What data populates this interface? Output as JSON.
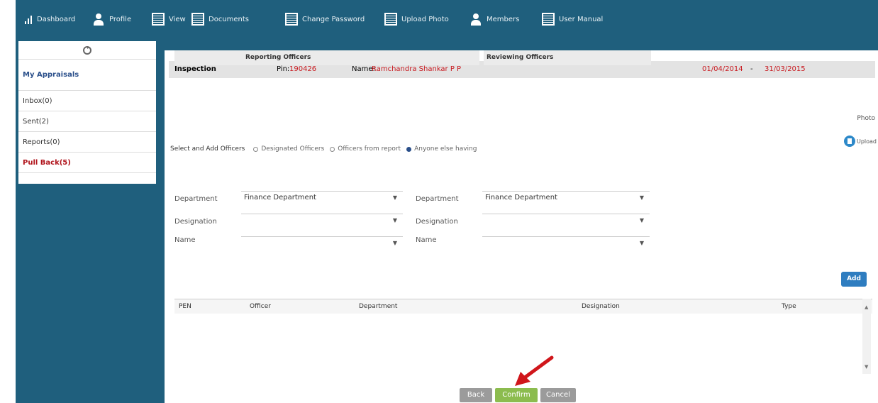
{
  "nav": {
    "items": [
      {
        "label": "Dashboard",
        "icon": "bar-chart-icon"
      },
      {
        "label": "Profile",
        "icon": "user-icon"
      },
      {
        "label": "View",
        "icon": "document-icon"
      },
      {
        "label": "Documents",
        "icon": "document-icon"
      },
      {
        "label": "Change Password",
        "icon": "document-icon"
      },
      {
        "label": "Upload Photo",
        "icon": "document-icon"
      },
      {
        "label": "Members",
        "icon": "user-icon"
      },
      {
        "label": "User Manual",
        "icon": "document-icon"
      }
    ]
  },
  "sidebar": {
    "items": [
      {
        "label": "My Appraisals"
      },
      {
        "label": "Inbox(0)"
      },
      {
        "label": "Sent(2)"
      },
      {
        "label": "Reports(0)"
      },
      {
        "label": "Pull Back(5)"
      }
    ]
  },
  "info": {
    "type": "Inspection",
    "pin_label": "Pin:",
    "pin_value": "190426",
    "name_label": "Name:",
    "name_value": "Ramchandra Shankar P P",
    "period_from": "01/04/2014",
    "period_sep": "-",
    "period_to": "31/03/2015"
  },
  "upload": {
    "top_label": "Photo",
    "button_label": "Upload"
  },
  "selection": {
    "lead": "Select and Add Officers",
    "options": [
      {
        "label": "Designated Officers",
        "selected": false
      },
      {
        "label": "Officers from report",
        "selected": false
      },
      {
        "label": "Anyone else having",
        "selected": true
      }
    ]
  },
  "reporting": {
    "header": "Reporting Officers",
    "department_label": "Department",
    "department_value": "Finance Department",
    "designation_label": "Designation",
    "designation_value": "",
    "name_label": "Name",
    "name_value": ""
  },
  "reviewing": {
    "header": "Reviewing Officers",
    "department_label": "Department",
    "department_value": "Finance Department",
    "designation_label": "Designation",
    "designation_value": "",
    "name_label": "Name",
    "name_value": ""
  },
  "add_button": "Add",
  "table": {
    "columns": [
      "PEN",
      "Officer",
      "Department",
      "Designation",
      "Type"
    ]
  },
  "buttons": {
    "back": "Back",
    "confirm": "Confirm",
    "cancel": "Cancel"
  },
  "colors": {
    "nav_bg": "#1f5f7d",
    "confirm_green": "#8cbc4f",
    "accent_red": "#c8191f",
    "add_blue": "#2e7dc0",
    "annotation_arrow": "#d0161b"
  }
}
